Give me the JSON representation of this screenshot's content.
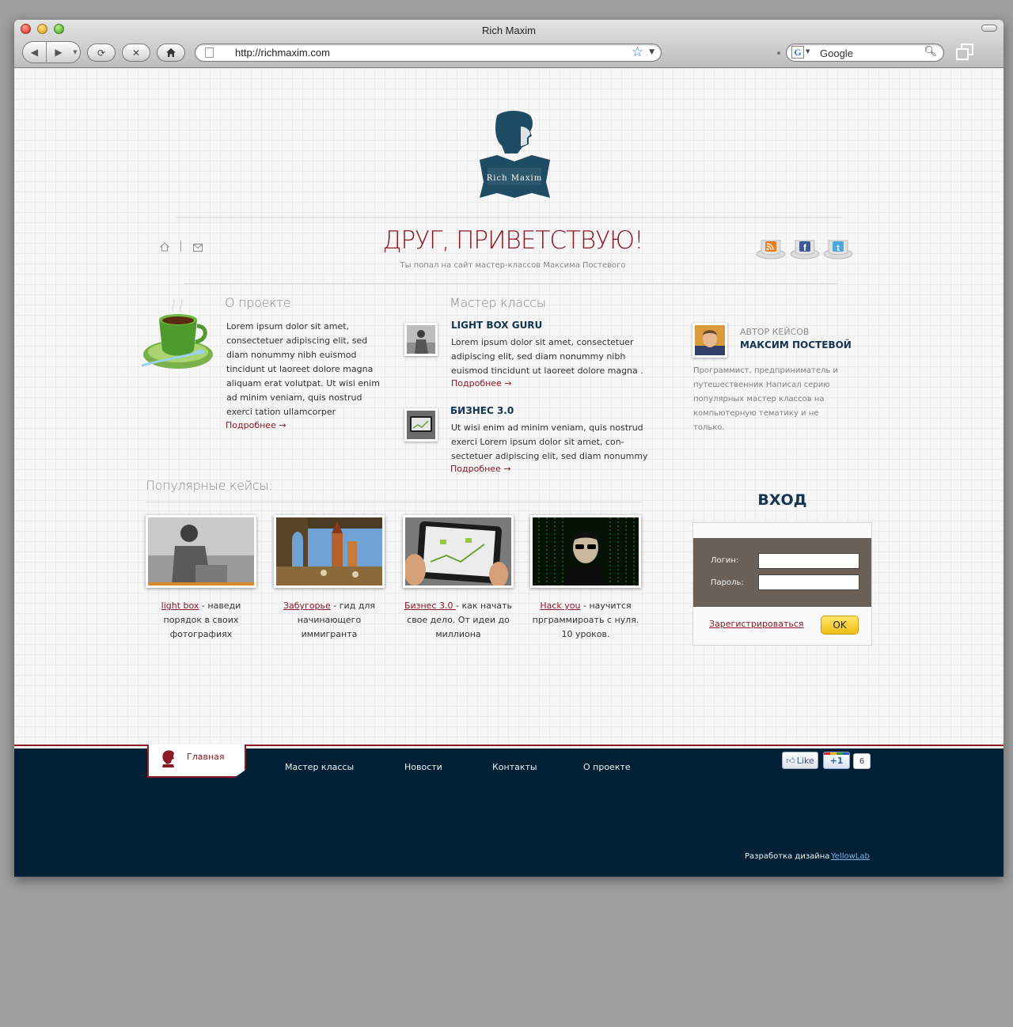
{
  "browser": {
    "title": "Rich Maxim",
    "url": "http://richmaxim.com",
    "search_placeholder": "Google"
  },
  "site": {
    "logo_text": "Rich Maxim",
    "headline": "ДРУГ, ПРИВЕТСТВУЮ!",
    "subheadline": "Ты попал на сайт мастер-классов Максима Постевого",
    "social_icons": [
      "rss-icon",
      "facebook-icon",
      "twitter-icon"
    ],
    "accent_color": "#8a1a25",
    "navy_color": "#002035"
  },
  "about": {
    "heading": "О проекте",
    "text": "Lorem ipsum dolor sit amet, consectetuer adipiscing elit, sed diam nonummy nibh euismod tincidunt ut laoreet dolore magna aliquam erat volutpat. Ut wisi enim ad minim veniam, quis nostrud exerci tation ullamcorper",
    "more": "Подробнее →"
  },
  "masterclasses": {
    "heading": "Мастер классы",
    "items": [
      {
        "title": "LIGHT BOX GURU",
        "text": "Lorem ipsum dolor sit amet, consectetuer adipiscing elit, sed diam nonummy nibh euismod tincidunt ut laoreet dolore magna .",
        "more": "Подробнее →"
      },
      {
        "title": "БИЗНЕС 3.0",
        "text": "Ut wisi enim ad minim veniam, quis nostrud exerci Lorem ipsum dolor sit amet, con-sectetuer adipiscing elit, sed diam nonummy",
        "more": "Подробнее →"
      }
    ]
  },
  "author": {
    "label": "АВТОР КЕЙСОВ",
    "name": "МАКСИМ ПОСТЕВОЙ",
    "bio": "Программист, предприниматель и путешественник Написал серию популярных мастер классов на компьютерную тематику и не только."
  },
  "popular": {
    "heading": "Популярные кейсы:",
    "cases": [
      {
        "link": "light box",
        "desc": " - наведи порядок в своих фотографиях"
      },
      {
        "link": "Забугорье",
        "desc": " - гид для начинающего иммигранта"
      },
      {
        "link": "Бизнес 3.0 ",
        "desc": " - как начать свое дело. От идеи до миллиона"
      },
      {
        "link": "Hack you",
        "desc": " - научится прграммироать с нуля. 10 уроков."
      }
    ]
  },
  "login": {
    "heading": "ВХОД",
    "login_label": "Логин:",
    "password_label": "Пароль:",
    "register": "Зарегистрироваться",
    "ok": "OK"
  },
  "footer": {
    "home": "Главная",
    "nav": [
      "Мастер классы",
      "Новости",
      "Контакты",
      "О проекте"
    ],
    "like": "Like",
    "plus": "+1",
    "plus_count": "6",
    "credit": "Разработка дизайна",
    "credit_link": "YellowLab"
  }
}
